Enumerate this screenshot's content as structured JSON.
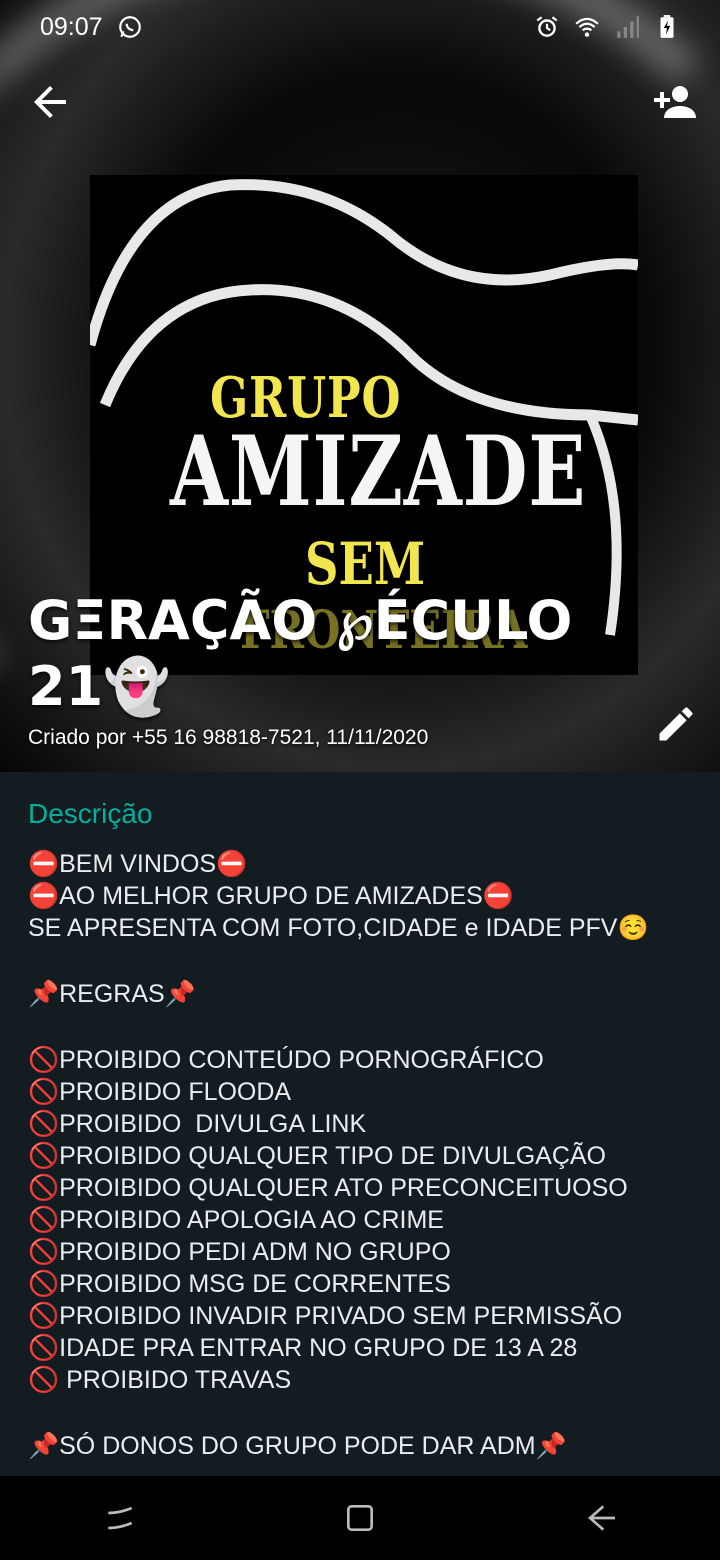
{
  "status_bar": {
    "time": "09:07",
    "icons": [
      "whatsapp-icon",
      "alarm-icon",
      "wifi-icon",
      "signal-icon",
      "battery-icon"
    ]
  },
  "header": {
    "back_icon": "arrow-left-icon",
    "add_participant_icon": "add-person-icon",
    "logo": {
      "line1": "GRUPO",
      "line2": "AMIZADE",
      "line3": "SEM",
      "line4": "FRONTEIRA"
    },
    "title_line1": "GΞRAÇÃO ℘ÉCULO",
    "title_line2": "21👻",
    "created_by": "Criado por +55 16 98818-7521, 11/11/2020",
    "edit_icon": "pencil-icon"
  },
  "description": {
    "label": "Descrição",
    "lines": [
      "⛔BEM VINDOS⛔",
      "⛔AO MELHOR GRUPO DE AMIZADES⛔",
      "SE APRESENTA COM FOTO,CIDADE e IDADE PFV☺️",
      "",
      "📌REGRAS📌",
      "",
      "🚫PROIBIDO CONTEÚDO PORNOGRÁFICO",
      "🚫PROIBIDO FLOODA",
      "🚫PROIBIDO  DIVULGA LINK",
      "🚫PROIBIDO QUALQUER TIPO DE DIVULGAÇÃO",
      "🚫PROIBIDO QUALQUER ATO PRECONCEITUOSO",
      "🚫PROIBIDO APOLOGIA AO CRIME",
      "🚫PROIBIDO PEDI ADM NO GRUPO",
      "🚫PROIBIDO MSG DE CORRENTES",
      "🚫PROIBIDO INVADIR PRIVADO SEM PERMISSÃO",
      "🚫IDADE PRA ENTRAR NO GRUPO DE 13 A 28",
      "🚫 PROIBIDO TRAVAS",
      "",
      "📌SÓ DONOS DO GRUPO PODE DAR ADM📌"
    ]
  },
  "nav": {
    "recent_icon": "recent-apps-icon",
    "home_icon": "home-icon",
    "back_icon": "nav-back-icon"
  },
  "colors": {
    "accent": "#00af9c",
    "background": "#131c21",
    "text": "#e9edef"
  }
}
